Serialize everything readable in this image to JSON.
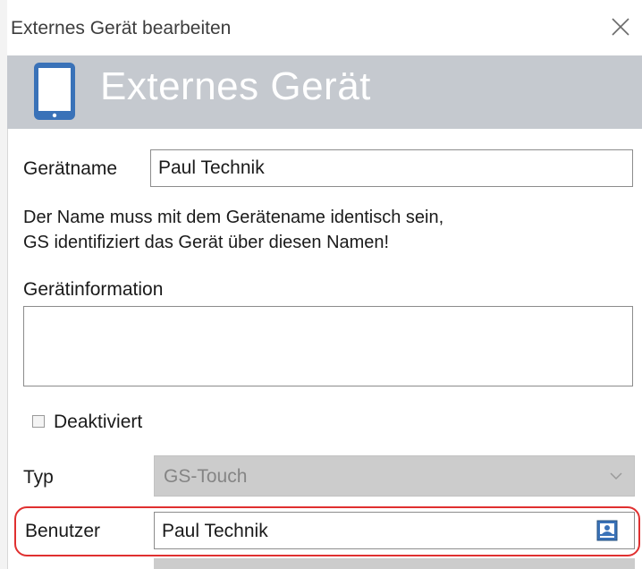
{
  "window": {
    "title": "Externes Gerät bearbeiten"
  },
  "banner": {
    "title": "Externes Gerät",
    "icon": "tablet-icon",
    "color": "#c5c9cf"
  },
  "form": {
    "device_name_label": "Gerätname",
    "device_name_value": "Paul Technik",
    "hint_line1": "Der Name muss mit dem Gerätename identisch sein,",
    "hint_line2": "GS identifiziert das Gerät über diesen Namen!",
    "device_info_label": "Gerätinformation",
    "device_info_value": "",
    "deactivated_label": "Deaktiviert",
    "deactivated_checked": false,
    "type_label": "Typ",
    "type_value": "GS-Touch",
    "user_label": "Benutzer",
    "user_value": "Paul Technik"
  },
  "colors": {
    "highlight": "#e03030",
    "icon_blue": "#3a72b8"
  }
}
